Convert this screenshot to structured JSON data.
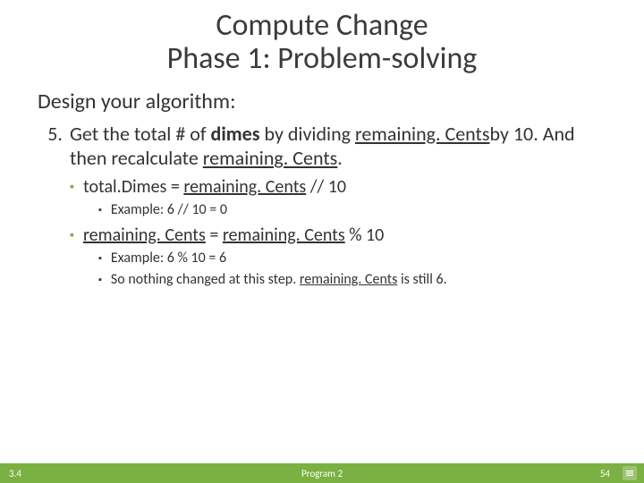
{
  "title": {
    "line1": "Compute Change",
    "line2": "Phase 1: Problem-solving"
  },
  "subhead": "Design your algorithm:",
  "step": {
    "num": "5.",
    "t1": "Get the total # of ",
    "bold1": "dimes",
    "t2": " by dividing ",
    "u1": "remaining. Cents",
    "t3": "by 10. And then recalculate ",
    "u2": "remaining. Cents",
    "t4": "."
  },
  "b1a": {
    "pre": "total",
    "mid": ".Dimes = ",
    "u": "remaining. Cents",
    "post": " // 10"
  },
  "b1a_ex": "Example: 6 // 10 = 0",
  "b1b": {
    "u1": "remaining. Cents",
    "mid": " = ",
    "u2": "remaining. Cents",
    "post": " % 10"
  },
  "b1b_ex1": "Example: 6 % 10 = 6",
  "b1b_ex2": {
    "pre": "So nothing changed at this step. ",
    "u": "remaining. Cents",
    "post": " is still 6."
  },
  "footer": {
    "section": "3.4",
    "program": "Program 2",
    "page": "54"
  }
}
